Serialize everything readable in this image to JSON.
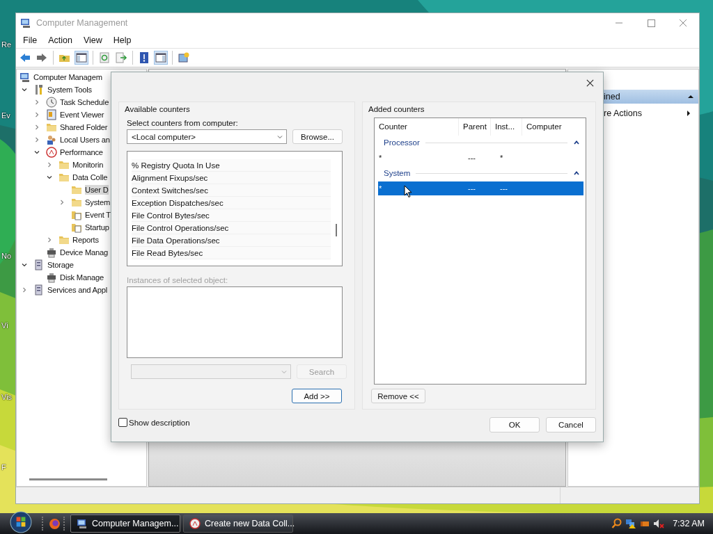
{
  "desktop": {
    "icon_labels": [
      "Re",
      "Ev",
      "No",
      "Vi",
      "Vis",
      "F"
    ]
  },
  "window": {
    "title": "Computer Management",
    "menu": [
      "File",
      "Action",
      "View",
      "Help"
    ],
    "tree": [
      {
        "label": "Computer Managem",
        "kind": "computer",
        "selected": false,
        "children": [
          {
            "label": "System Tools",
            "kind": "tools",
            "expanded": true,
            "selected": false,
            "children": [
              {
                "label": "Task Schedule",
                "kind": "clock",
                "expanded": false,
                "selected": false
              },
              {
                "label": "Event Viewer",
                "kind": "log",
                "expanded": false,
                "selected": false
              },
              {
                "label": "Shared Folder",
                "kind": "folder",
                "expanded": false,
                "selected": false
              },
              {
                "label": "Local Users an",
                "kind": "users",
                "expanded": false,
                "selected": false
              },
              {
                "label": "Performance",
                "kind": "gauge",
                "expanded": true,
                "selected": false,
                "children": [
                  {
                    "label": "Monitorin",
                    "kind": "folder",
                    "expanded": false,
                    "selected": false
                  },
                  {
                    "label": "Data Colle",
                    "kind": "folder",
                    "expanded": true,
                    "selected": false,
                    "children": [
                      {
                        "label": "User D",
                        "kind": "folder",
                        "selected": true
                      },
                      {
                        "label": "System",
                        "kind": "folder",
                        "expanded": false,
                        "selected": false
                      },
                      {
                        "label": "Event T",
                        "kind": "doc-folder",
                        "selected": false
                      },
                      {
                        "label": "Startup",
                        "kind": "doc-folder",
                        "selected": false
                      }
                    ]
                  },
                  {
                    "label": "Reports",
                    "kind": "folder",
                    "expanded": false,
                    "selected": false
                  }
                ]
              },
              {
                "label": "Device Manag",
                "kind": "device",
                "selected": false
              }
            ]
          },
          {
            "label": "Storage",
            "kind": "storage",
            "expanded": true,
            "selected": false,
            "children": [
              {
                "label": "Disk Manage",
                "kind": "disk",
                "selected": false
              }
            ]
          },
          {
            "label": "Services and Appl",
            "kind": "services",
            "expanded": false,
            "selected": false
          }
        ]
      }
    ],
    "actions": {
      "header": "ined",
      "items": [
        "re Actions"
      ]
    }
  },
  "dialog": {
    "available": {
      "title": "Available counters",
      "computer_label": "Select counters from computer:",
      "computer": "<Local computer>",
      "browse": "Browse...",
      "counters": [
        "% Registry Quota In Use",
        "Alignment Fixups/sec",
        "Context Switches/sec",
        "Exception Dispatches/sec",
        "File Control Bytes/sec",
        "File Control Operations/sec",
        "File Data Operations/sec",
        "File Read Bytes/sec"
      ],
      "instances": {
        "label": "Instances of selected object:",
        "disabled": true
      },
      "search": {
        "label": "Search",
        "disabled": true
      },
      "add": "Add >>"
    },
    "added": {
      "title": "Added counters",
      "columns": [
        "Counter",
        "Parent",
        "Inst...",
        "Computer"
      ],
      "groups": [
        {
          "name": "Processor",
          "expanded": true,
          "rows": [
            {
              "cells": [
                "*",
                "---",
                "*"
              ],
              "selected": false
            }
          ]
        },
        {
          "name": "System",
          "expanded": true,
          "rows": [
            {
              "cells": [
                "*",
                "---",
                "---"
              ],
              "selected": true
            }
          ]
        }
      ],
      "remove": "Remove <<"
    },
    "show_description": {
      "label": "Show description",
      "checked": false
    },
    "buttons": [
      "OK",
      "Cancel"
    ]
  },
  "taskbar": {
    "buttons": [
      {
        "label": "Computer Managem...",
        "selected": true
      },
      {
        "label": "Create new Data Coll...",
        "selected": false
      }
    ],
    "clock": "7:32 AM"
  }
}
